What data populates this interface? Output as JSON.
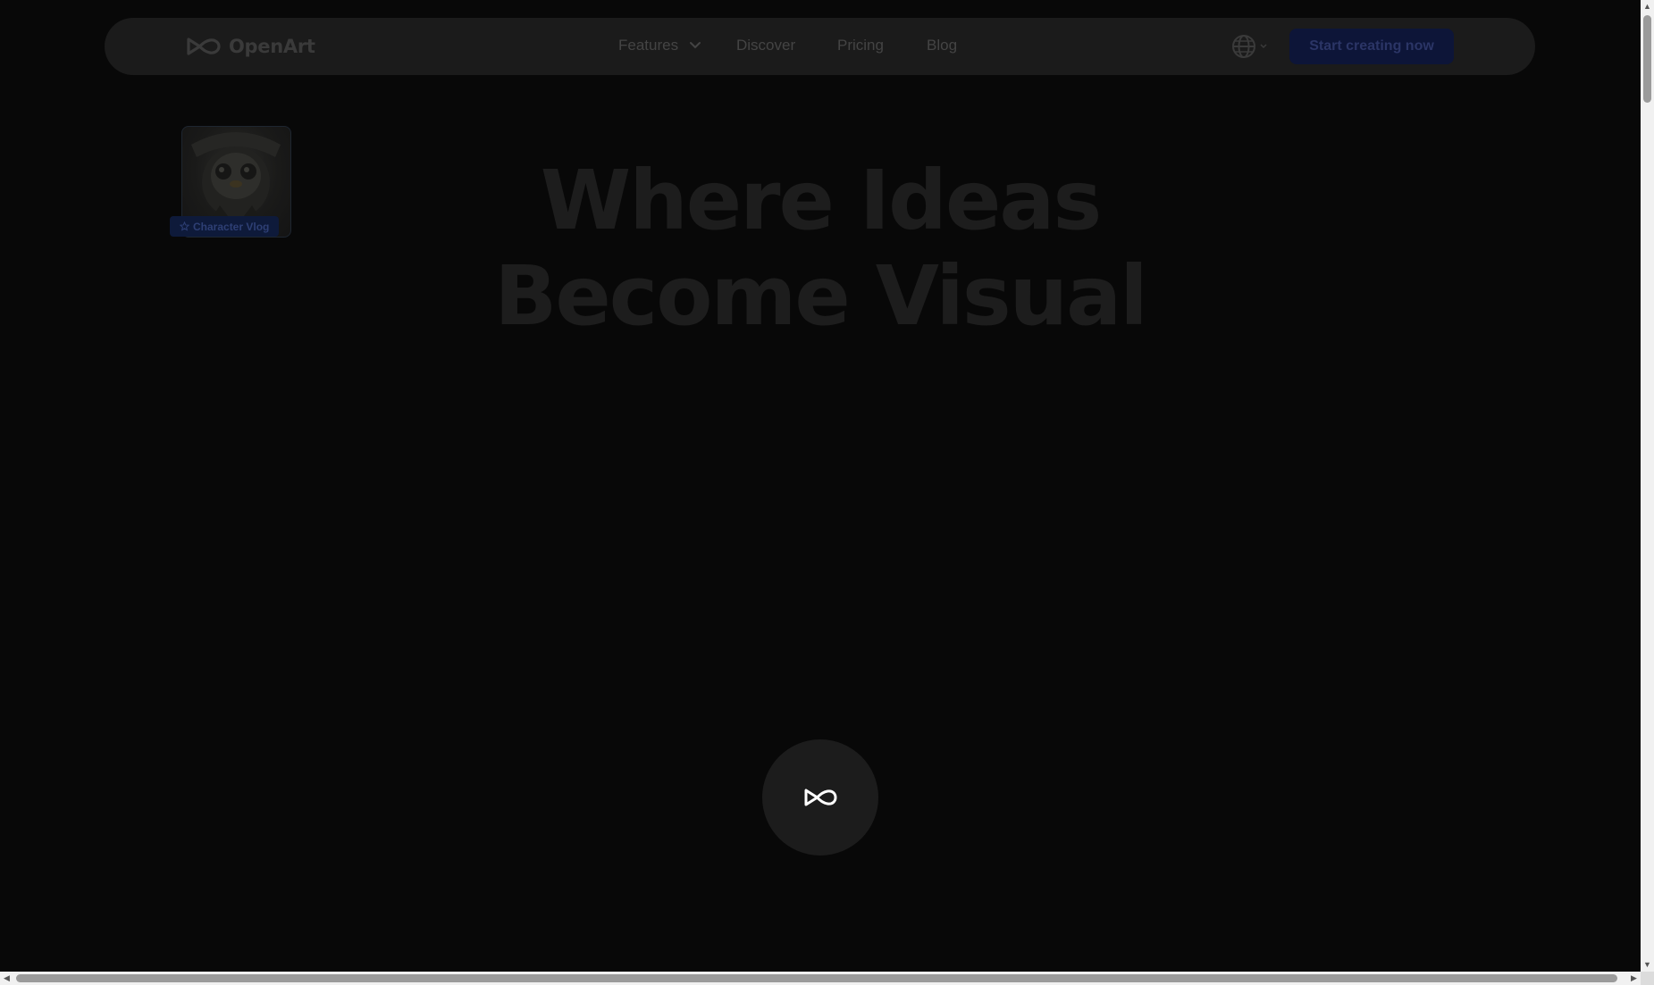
{
  "brand": {
    "name": "OpenArt",
    "logo_icon": "infinity-logo-icon"
  },
  "nav": {
    "links": [
      {
        "label": "Features",
        "has_dropdown": true
      },
      {
        "label": "Discover"
      },
      {
        "label": "Pricing"
      },
      {
        "label": "Blog"
      }
    ],
    "language_icon": "globe-icon",
    "cta_label": "Start creating now"
  },
  "showcase": {
    "badge_icon": "star-icon",
    "badge_label": "Character Vlog"
  },
  "hero": {
    "line1": "Where Ideas",
    "line2": "Become Visual"
  },
  "loader": {
    "icon": "infinity-loader-icon"
  },
  "colors": {
    "background": "#080808",
    "navbar": "#1b1b1b",
    "cta": "#0d1538"
  }
}
